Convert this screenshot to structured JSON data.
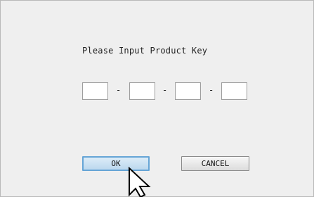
{
  "dialog": {
    "prompt": "Please Input Product Key",
    "key_fields": [
      {
        "value": ""
      },
      {
        "value": ""
      },
      {
        "value": ""
      },
      {
        "value": ""
      }
    ],
    "separator": "-",
    "ok_label": "OK",
    "cancel_label": "CANCEL"
  },
  "cursor": {
    "icon": "arrow-cursor-icon"
  },
  "colors": {
    "dialog_background": "#efefef",
    "ok_button_border": "#66a5d6",
    "ok_button_fill": "#cfe4f5"
  }
}
